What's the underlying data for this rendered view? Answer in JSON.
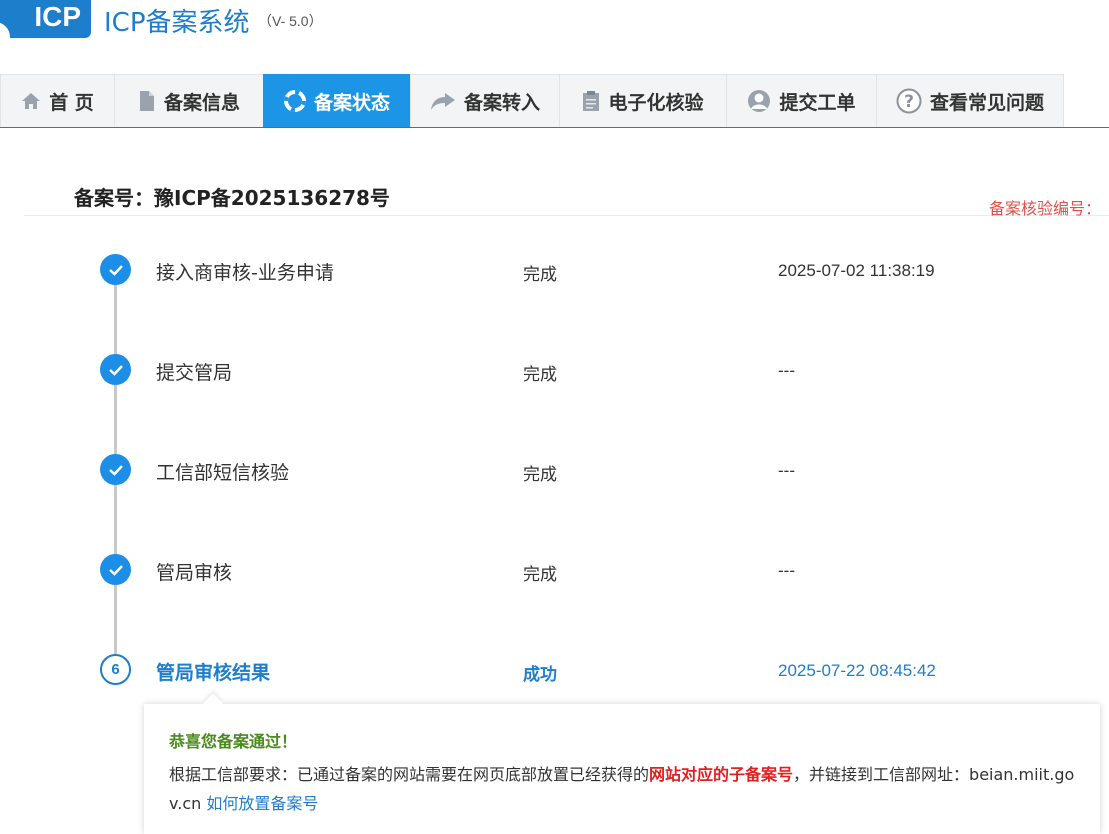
{
  "header": {
    "logo": "ICP",
    "title": "ICP备案系统",
    "version": "（V- 5.0）"
  },
  "nav": {
    "tabs": [
      {
        "label": "首 页",
        "icon": "home-icon"
      },
      {
        "label": "备案信息",
        "icon": "document-icon"
      },
      {
        "label": "备案状态",
        "icon": "lifebuoy-icon",
        "active": true
      },
      {
        "label": "备案转入",
        "icon": "share-arrow-icon"
      },
      {
        "label": "电子化核验",
        "icon": "clipboard-icon"
      },
      {
        "label": "提交工单",
        "icon": "user-icon"
      },
      {
        "label": "查看常见问题",
        "icon": "question-icon"
      }
    ]
  },
  "record": {
    "title": "备案号：豫ICP备2025136278号",
    "verify_label": "备案核验编号："
  },
  "steps": [
    {
      "name": "接入商审核-业务申请",
      "status": "完成",
      "time": "2025-07-02 11:38:19",
      "icon": "check-icon"
    },
    {
      "name": "提交管局",
      "status": "完成",
      "time": "---",
      "icon": "check-icon"
    },
    {
      "name": "工信部短信核验",
      "status": "完成",
      "time": "---",
      "icon": "check-icon"
    },
    {
      "name": "管局审核",
      "status": "完成",
      "time": "---",
      "icon": "check-icon"
    },
    {
      "name": "管局审核结果",
      "status": "成功",
      "time": "2025-07-22 08:45:42",
      "number": "6"
    }
  ],
  "result": {
    "congrats": "恭喜您备案通过！",
    "text_before": "根据工信部要求：已通过备案的网站需要在网页底部放置已经获得的",
    "text_red": "网站对应的子备案号",
    "text_after": "，并链接到工信部网址：beian.miit.gov.cn ",
    "link": "如何放置备案号"
  },
  "colors": {
    "brand": "#1d7ecb",
    "active_tab": "#1d95e6",
    "success_green": "#4b8a1d",
    "alert_red": "#e02020"
  }
}
